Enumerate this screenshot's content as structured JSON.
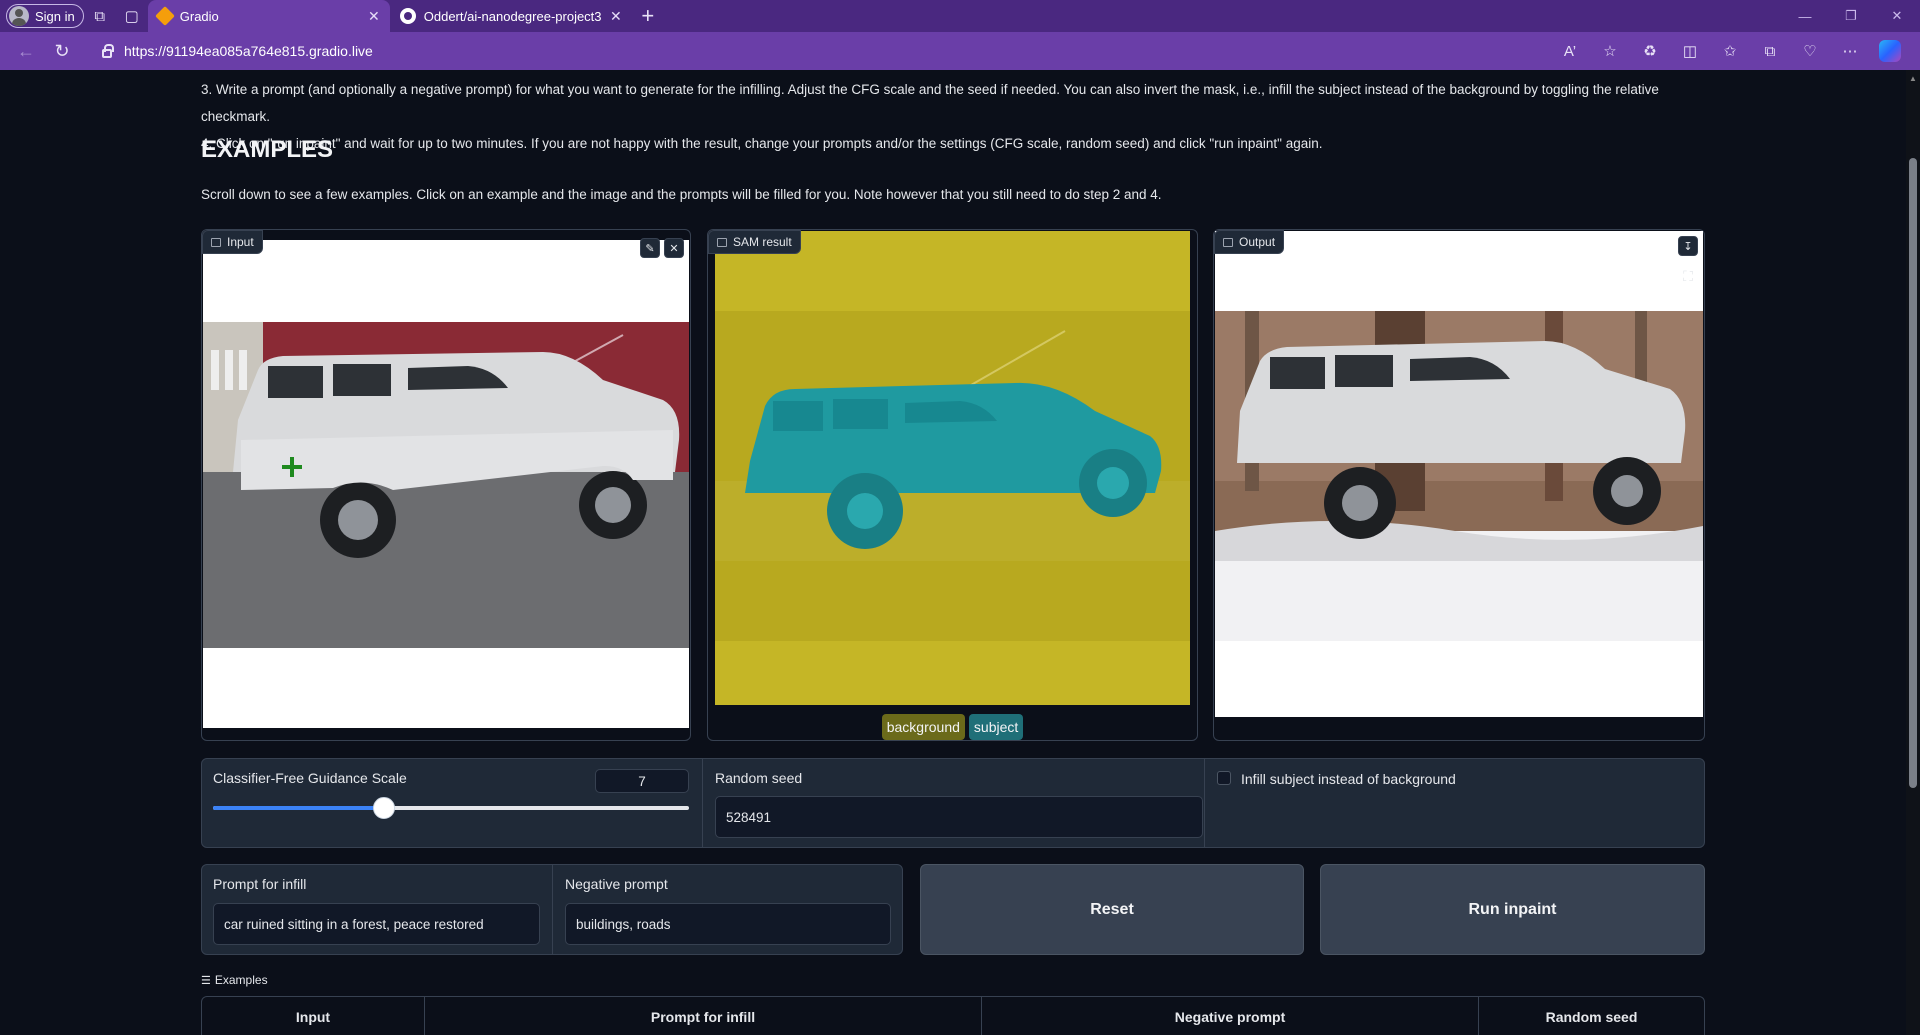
{
  "browser": {
    "signin_label": "Sign in",
    "tabs": [
      {
        "title": "Gradio",
        "active": true
      },
      {
        "title": "Oddert/ai-nanodegree-project3",
        "active": false
      }
    ],
    "url": "https://91194ea085a764e815.gradio.live"
  },
  "instructions": {
    "step3": "3. Write a prompt (and optionally a negative prompt) for what you want to generate for the infilling. Adjust the CFG scale and the seed if needed. You can also invert the mask, i.e., infill the subject instead of the background by toggling the relative checkmark.",
    "step4": "4. Click on \"run inpaint\" and wait for up to two minutes. If you are not happy with the result, change your prompts and/or the settings (CFG scale, random seed) and click \"run inpaint\" again."
  },
  "examples_section": {
    "heading": "EXAMPLES",
    "text": "Scroll down to see a few examples. Click on an example and the image and the prompts will be filled for you. Note however that you still need to do step 2 and 4."
  },
  "panels": {
    "input_label": "Input",
    "sam_label": "SAM result",
    "output_label": "Output",
    "legend": [
      {
        "label": "background",
        "color": "#6b6a1a"
      },
      {
        "label": "subject",
        "color": "#1f6f78"
      }
    ]
  },
  "controls": {
    "cfg_label": "Classifier-Free Guidance Scale",
    "cfg_value": "7",
    "cfg_fraction": 0.36,
    "seed_label": "Random seed",
    "seed_value": "528491",
    "invert_label": "Infill subject instead of background",
    "invert_checked": false
  },
  "prompts": {
    "prompt_label": "Prompt for infill",
    "prompt_value": "car ruined sitting in a forest, peace restored",
    "negative_label": "Negative prompt",
    "negative_value": "buildings, roads",
    "reset_label": "Reset",
    "run_label": "Run inpaint"
  },
  "examples_table": {
    "label": "Examples",
    "columns": [
      "Input",
      "Prompt for infill",
      "Negative prompt",
      "Random seed"
    ]
  },
  "colors": {
    "browser_tabbar": "#4a2880",
    "browser_toolbar": "#6a3ea8",
    "page_bg": "#0b0f19",
    "slider_accent": "#3b82f6",
    "sam_background": "#c0b224",
    "sam_subject": "#1f9aa0"
  }
}
